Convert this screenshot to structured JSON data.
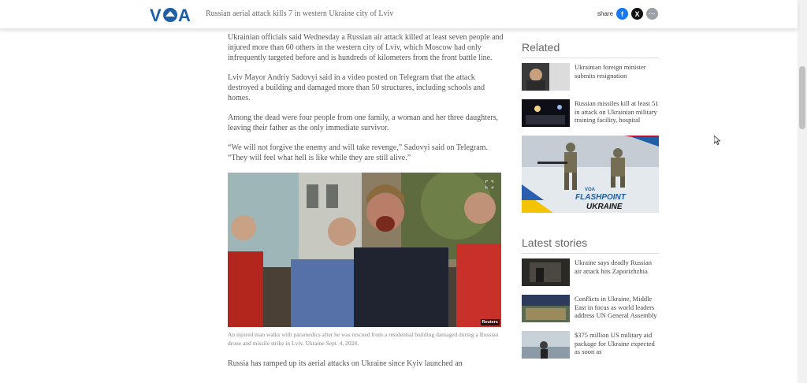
{
  "header": {
    "logo_text": "VOA",
    "title": "Russian aerial attack kills 7 in western Ukraine city of Lviv",
    "share_label": "share",
    "share_buttons": {
      "facebook": "f",
      "x": "X",
      "more": "···"
    }
  },
  "article": {
    "paragraphs": [
      "Ukrainian officials said Wednesday a Russian air attack killed at least seven people and injured more than 60 others in the western city of Lviv, which Moscow had only infrequently targeted before and is hundreds of kilometers from the front battle line.",
      "Lviv Mayor Andriy Sadovyi said in a video posted on Telegram that the attack destroyed a building and damaged more than 50 structures, including schools and homes.",
      "Among the dead were four people from one family, a woman and her three daughters, leaving their father as the only immediate survivor.",
      "“We will not forgive the enemy and will take revenge,” Sadovyi said on Telegram. “They will feel what hell is like while they are still alive.”"
    ],
    "photo_credit": "Reuters",
    "caption": "An injured man walks with paramedics after he was rescued from a residential building damaged during a Russian drone and missile strike in Lviv, Ukraine Sept. 4, 2024.",
    "last_paragraph": "Russia has ramped up its aerial attacks on Ukraine since Kyiv launched an"
  },
  "sidebar": {
    "related_title": "Related",
    "related": [
      {
        "title": "Ukrainian foreign minister submits resignation"
      },
      {
        "title": "Russian missiles kill at least 51 in attack on Ukrainian military training facility, hospital"
      }
    ],
    "ad": {
      "logo": "VOA",
      "line1": "FLASHPOINT",
      "line2": "UKRAINE"
    },
    "latest_title": "Latest stories",
    "latest": [
      {
        "title": "Ukraine says deadly Russian air attack hits Zaporizhzhia"
      },
      {
        "title": "Conflicts in Ukraine, Middle East in focus as world leaders address UN General Assembly"
      },
      {
        "title": "$375 million US military aid package for Ukraine expected as soon as"
      }
    ]
  },
  "colors": {
    "brand_blue": "#1e5fa8",
    "facebook": "#1877f2",
    "x": "#111111",
    "more": "#9aa0a6"
  }
}
